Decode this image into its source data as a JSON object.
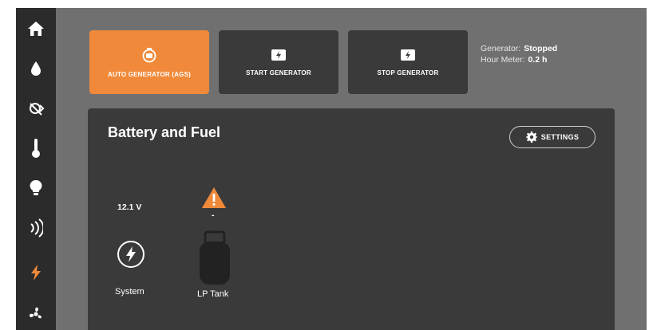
{
  "sidebar": {
    "items": [
      {
        "icon": "home-icon"
      },
      {
        "icon": "water-drop-icon"
      },
      {
        "icon": "awning-icon"
      },
      {
        "icon": "thermometer-icon"
      },
      {
        "icon": "light-bulb-icon"
      },
      {
        "icon": "signal-icon"
      },
      {
        "icon": "power-bolt-icon",
        "active": true
      },
      {
        "icon": "fan-icon"
      }
    ],
    "active_color": "#f08a3a"
  },
  "generator": {
    "tiles": [
      {
        "label": "AUTO GENERATOR (AGS)",
        "icon": "auto-generator-icon",
        "active": true
      },
      {
        "label": "START GENERATOR",
        "icon": "start-generator-icon",
        "active": false
      },
      {
        "label": "STOP GENERATOR",
        "icon": "stop-generator-icon",
        "active": false
      }
    ],
    "status_label": "Generator:",
    "status_value": "Stopped",
    "hour_meter_label": "Hour Meter:",
    "hour_meter_value": "0.2 h"
  },
  "panel": {
    "title": "Battery and Fuel",
    "settings_label": "SETTINGS",
    "system": {
      "value": "12.1 V",
      "label": "System",
      "icon": "bolt-icon"
    },
    "lp_tank": {
      "value": "-",
      "label": "LP Tank",
      "icon": "propane-tank-icon",
      "warning_icon": "warning-icon"
    }
  }
}
